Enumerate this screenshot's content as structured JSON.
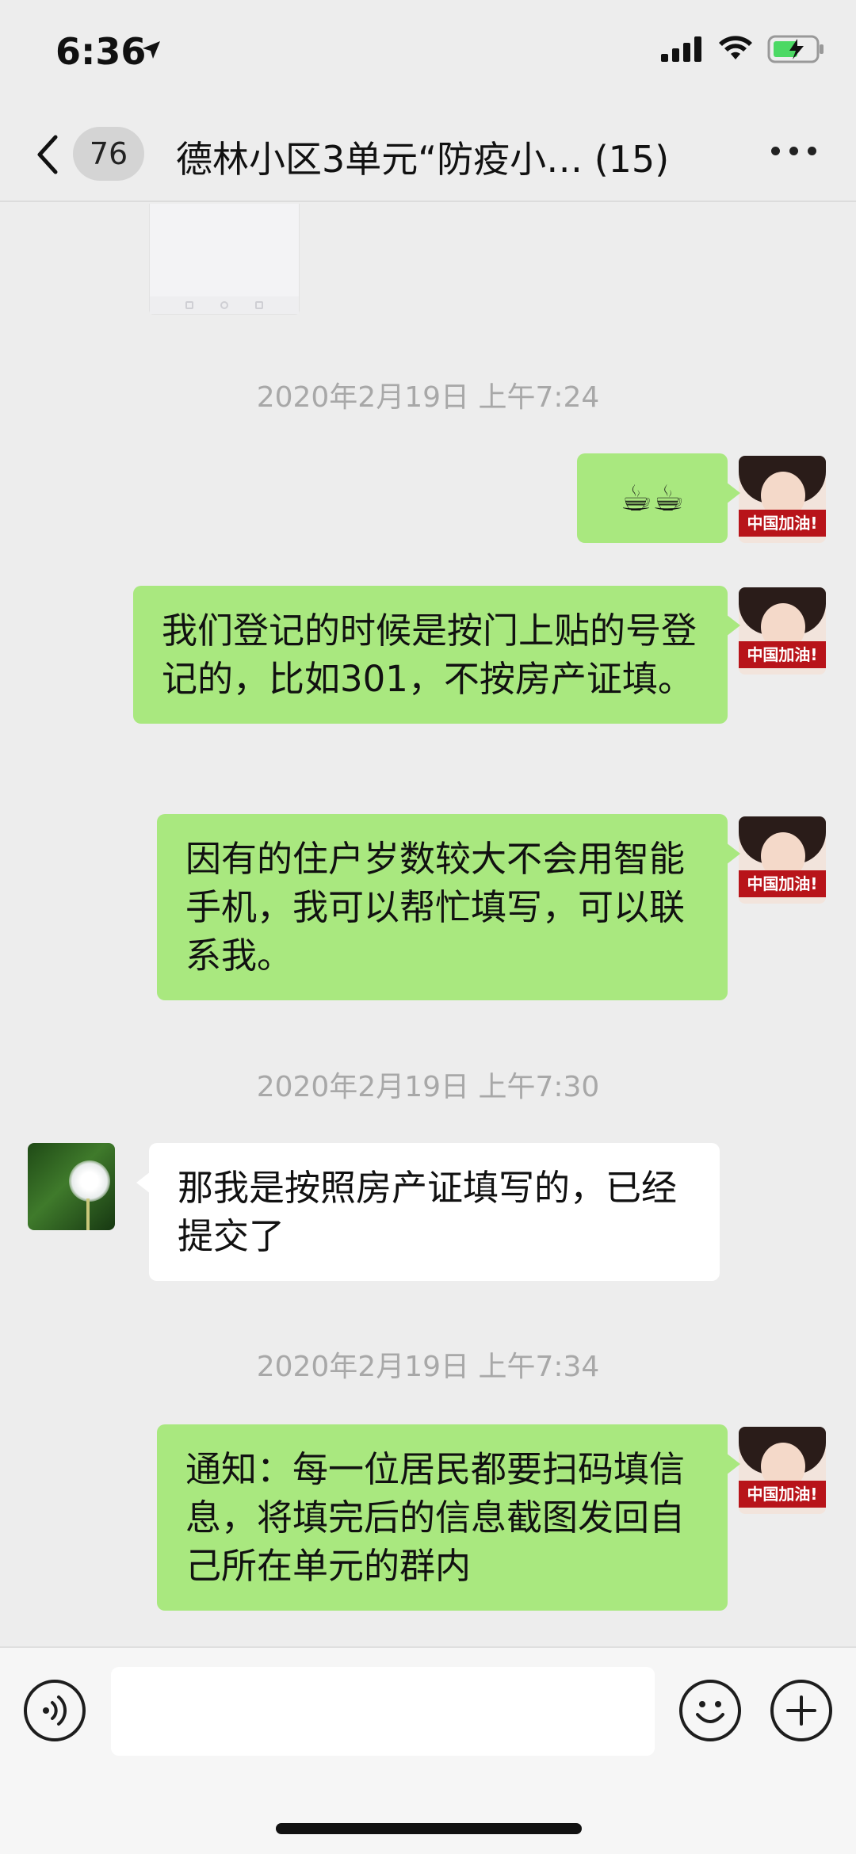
{
  "status_bar": {
    "time": "6:36"
  },
  "nav": {
    "unread_count": "76",
    "title": "德林小区3单元“防疫小… (15)"
  },
  "messages": {
    "ts1": "2020年2月19日 上午7:24",
    "m1": "☕☕",
    "m2": "我们登记的时候是按门上贴的号登记的，比如301，不按房产证填。",
    "m3": "因有的住户岁数较大不会用智能手机，我可以帮忙填写，可以联系我。",
    "ts2": "2020年2月19日 上午7:30",
    "m4": "那我是按照房产证填写的，已经提交了",
    "ts3": "2020年2月19日 上午7:34",
    "m5": "通知：每一位居民都要扫码填信息，将填完后的信息截图发回自己所在单元的群内"
  },
  "avatar_me": {
    "banner_text": "中国加油!"
  },
  "input_bar": {
    "value": ""
  }
}
